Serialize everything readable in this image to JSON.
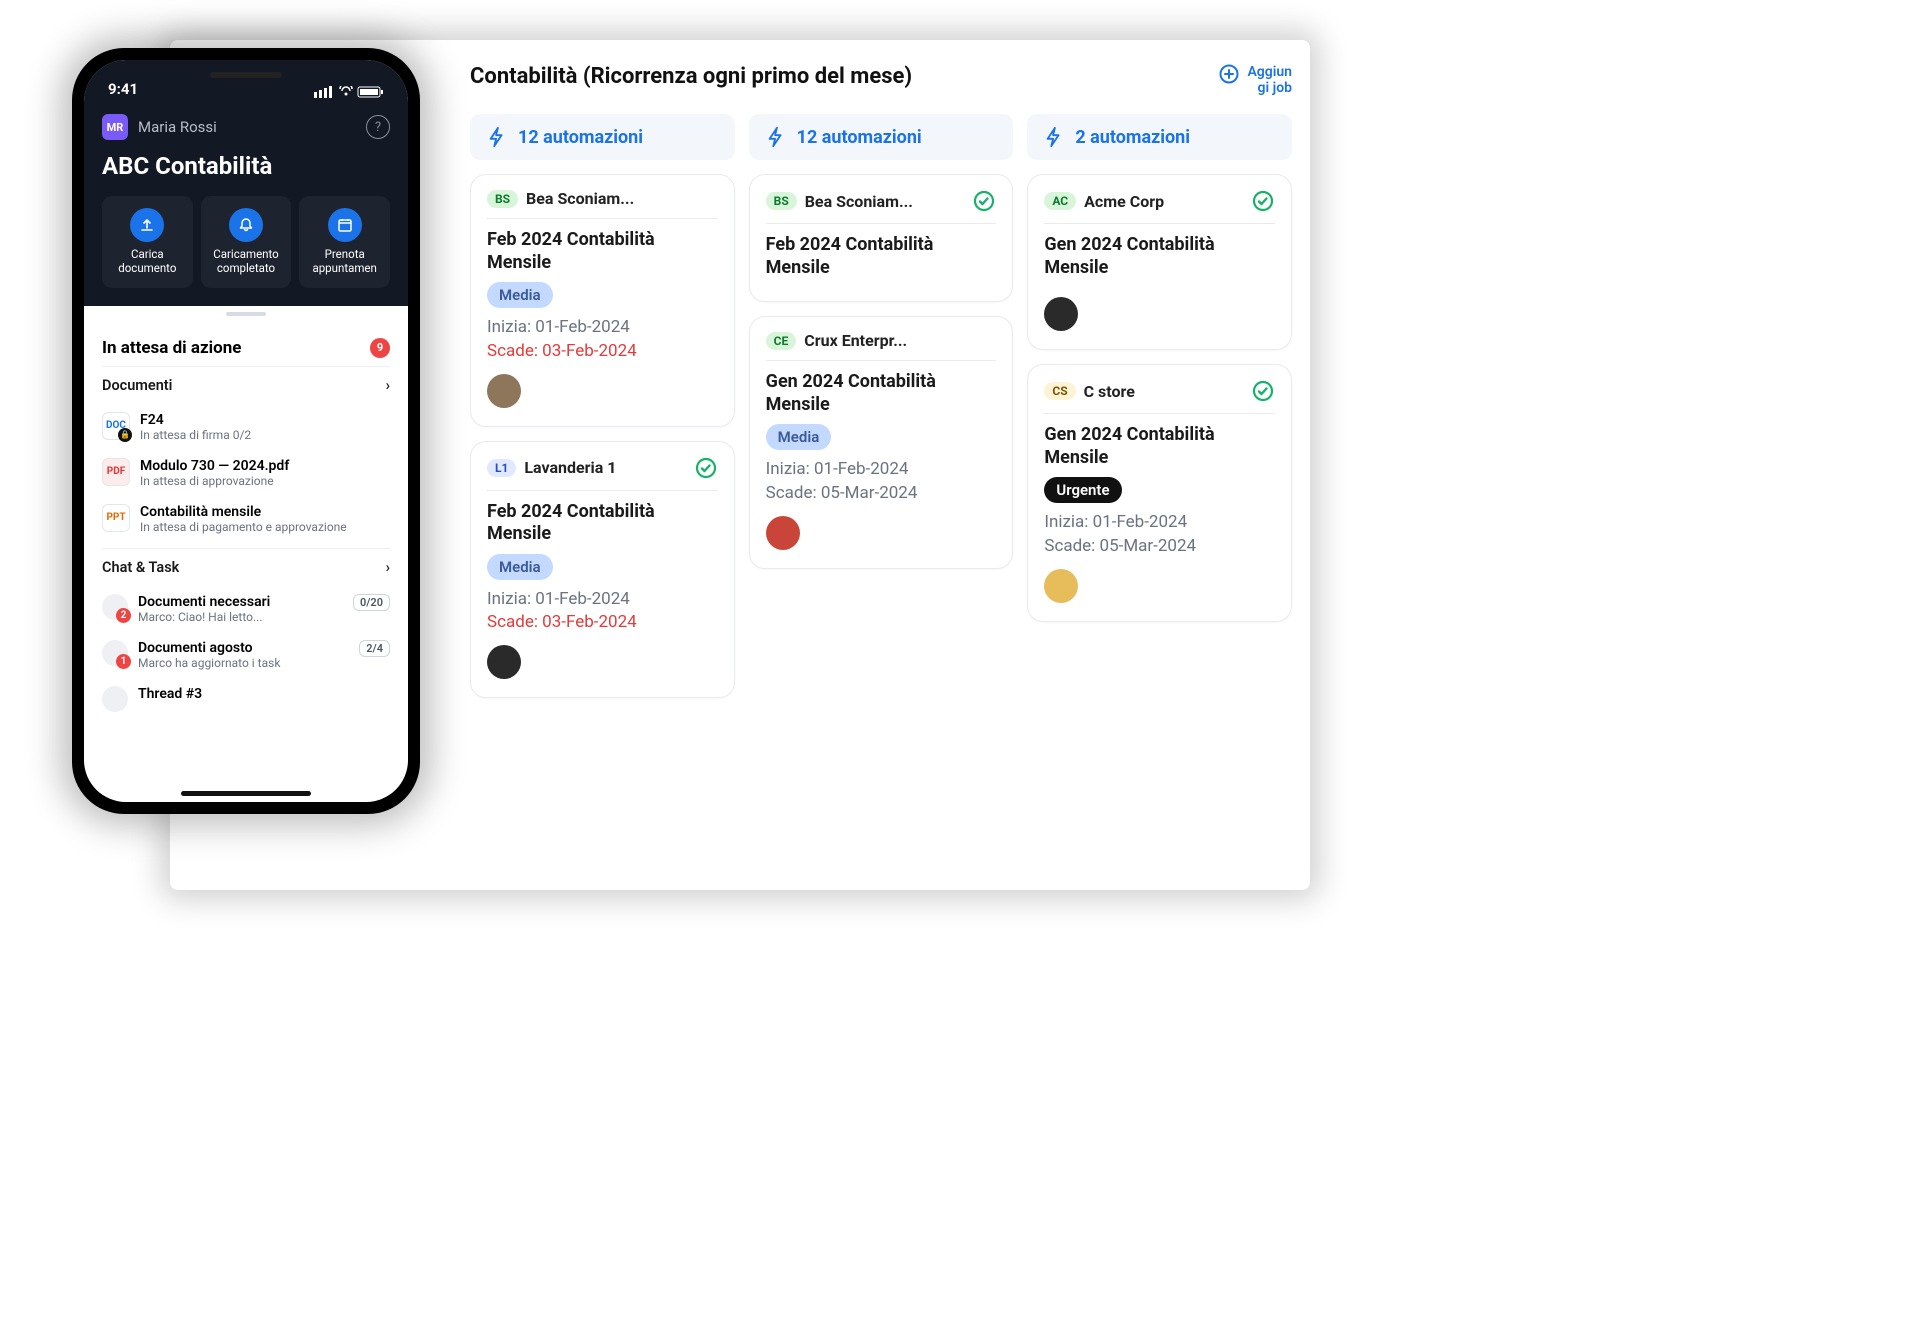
{
  "board": {
    "title": "Contabilità (Ricorrenza ogni primo del mese)",
    "add_job": "Aggiun\ngi job",
    "columns": [
      {
        "automations": "12 automazioni",
        "cards": [
          {
            "tag": "BS",
            "tag_cls": "bs",
            "client": "Bea Sconiam...",
            "checked": false,
            "title": "Feb 2024 Contabilità Mensile",
            "pill": "Media",
            "pill_cls": "media",
            "start": "Inizia: 01-Feb-2024",
            "due": "Scade: 03-Feb-2024",
            "due_red": true,
            "avatar_cls": "a3"
          },
          {
            "tag": "L1",
            "tag_cls": "l1",
            "client": "Lavanderia 1",
            "checked": true,
            "title": "Feb 2024 Contabilità Mensile",
            "pill": "Media",
            "pill_cls": "media",
            "start": "Inizia: 01-Feb-2024",
            "due": "Scade: 03-Feb-2024",
            "due_red": true,
            "avatar_cls": "a5"
          }
        ]
      },
      {
        "automations": "12 automazioni",
        "cards": [
          {
            "tag": "BS",
            "tag_cls": "bs",
            "client": "Bea Sconiam...",
            "checked": true,
            "title": "Feb 2024 Contabilità Mensile",
            "pill": "",
            "pill_cls": "",
            "start": "",
            "due": "",
            "due_red": false,
            "avatar_cls": ""
          },
          {
            "tag": "CE",
            "tag_cls": "ce",
            "client": "Crux Enterpr...",
            "checked": false,
            "title": "Gen 2024 Contabilità Mensile",
            "pill": "Media",
            "pill_cls": "media",
            "start": "Inizia: 01-Feb-2024",
            "due": "Scade: 05-Mar-2024",
            "due_red": false,
            "avatar_cls": "a2"
          }
        ]
      },
      {
        "automations": "2 automazioni",
        "cards": [
          {
            "tag": "AC",
            "tag_cls": "ac",
            "client": "Acme Corp",
            "checked": true,
            "title": "Gen 2024 Contabilità Mensile",
            "pill": "",
            "pill_cls": "",
            "start": "",
            "due": "",
            "due_red": false,
            "avatar_cls": "a5"
          },
          {
            "tag": "CS",
            "tag_cls": "cs",
            "client": "C store",
            "checked": true,
            "title": "Gen 2024 Contabilità Mensile",
            "pill": "Urgente",
            "pill_cls": "urgent",
            "start": "Inizia: 01-Feb-2024",
            "due": "Scade: 05-Mar-2024",
            "due_red": false,
            "avatar_cls": "a4"
          }
        ]
      }
    ]
  },
  "phone": {
    "time": "9:41",
    "user": {
      "initials": "MR",
      "name": "Maria Rossi"
    },
    "firm": "ABC Contabilità",
    "actions": [
      {
        "label": "Carica documento",
        "icon": "upload"
      },
      {
        "label": "Caricamento completato",
        "icon": "bell"
      },
      {
        "label": "Prenota appuntamen",
        "icon": "calendar"
      }
    ],
    "pending": {
      "title": "In attesa di azione",
      "count": "9"
    },
    "docs_header": "Documenti",
    "docs": [
      {
        "icon": "doc1",
        "title": "F24",
        "sub": "In attesa di firma 0/2",
        "lock": true
      },
      {
        "icon": "pdf",
        "title": "Modulo 730 — 2024.pdf",
        "sub": "In attesa di approvazione",
        "lock": false
      },
      {
        "icon": "ppt",
        "title": "Contabilità mensile",
        "sub": "In attesa di pagamento e approvazione",
        "lock": false
      }
    ],
    "chat_header": "Chat & Task",
    "chats": [
      {
        "badge": "2",
        "title": "Documenti necessari",
        "sub": "Marco: Ciao! Hai letto...",
        "prog": "0/20"
      },
      {
        "badge": "1",
        "title": "Documenti agosto",
        "sub": "Marco ha aggiornato i task",
        "prog": "2/4"
      },
      {
        "badge": "",
        "title": "Thread #3",
        "sub": "",
        "prog": ""
      }
    ]
  }
}
